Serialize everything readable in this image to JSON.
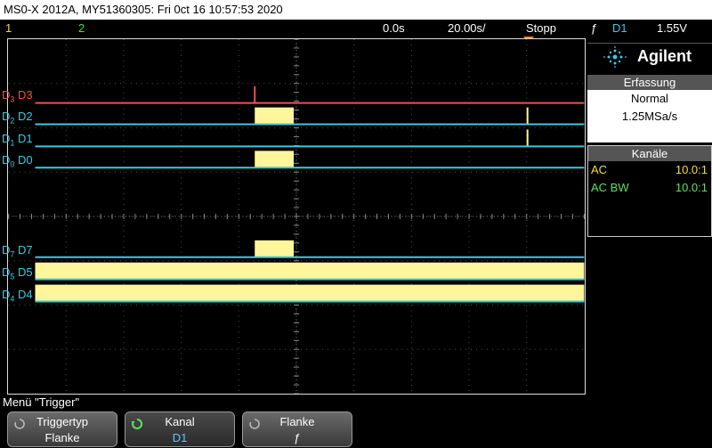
{
  "title": "MS0-X 2012A, MY51360305: Fri 0ct 16 10:57:53 2020",
  "status": {
    "ch1": "1",
    "ch2": "2",
    "delay": "0.0s",
    "timebase": "20.00s/",
    "run_state": "Stopp",
    "trigger_symbol": "ƒ",
    "trigger_source": "D1",
    "trigger_level": "1.55V"
  },
  "channels": [
    {
      "name": "D3",
      "prefix": "D",
      "sub": "3",
      "color": "#f05050"
    },
    {
      "name": "D2",
      "prefix": "D",
      "sub": "2",
      "color": "#3dc8e0"
    },
    {
      "name": "D1",
      "prefix": "D",
      "sub": "1",
      "color": "#3dc8e0"
    },
    {
      "name": "D0",
      "prefix": "D",
      "sub": "0",
      "color": "#3dc8e0"
    },
    {
      "name": "D7",
      "prefix": "D",
      "sub": "7",
      "color": "#3dc8e0"
    },
    {
      "name": "D5",
      "prefix": "D",
      "sub": "5",
      "color": "#3dc8e0"
    },
    {
      "name": "D4",
      "prefix": "D",
      "sub": "4",
      "color": "#3dc8e0"
    }
  ],
  "brand": "Agilent",
  "acquisition": {
    "header": "Erfassung",
    "mode": "Normal",
    "rate": "1.25MSa/s"
  },
  "channels_panel": {
    "header": "Kanäle",
    "rows": [
      {
        "key": "AC",
        "value": "10.0:1",
        "color": "yellow"
      },
      {
        "key": "AC BW",
        "value": "10.0:1",
        "color": "green"
      }
    ]
  },
  "menu": {
    "title": "Menü \"Trigger\"",
    "softkeys": [
      {
        "top": "Triggertyp",
        "bottom": "Flanke"
      },
      {
        "top": "Kanal",
        "bottom": "D1"
      },
      {
        "top": "Flanke",
        "bottom": "ƒ"
      }
    ]
  },
  "colors": {
    "digital_trace": "#3dc8e0",
    "ch1": "#f0e040",
    "ch2": "#40e040",
    "trigger_marker": "#f08c1c",
    "pulse_fill": "#fff59a"
  }
}
